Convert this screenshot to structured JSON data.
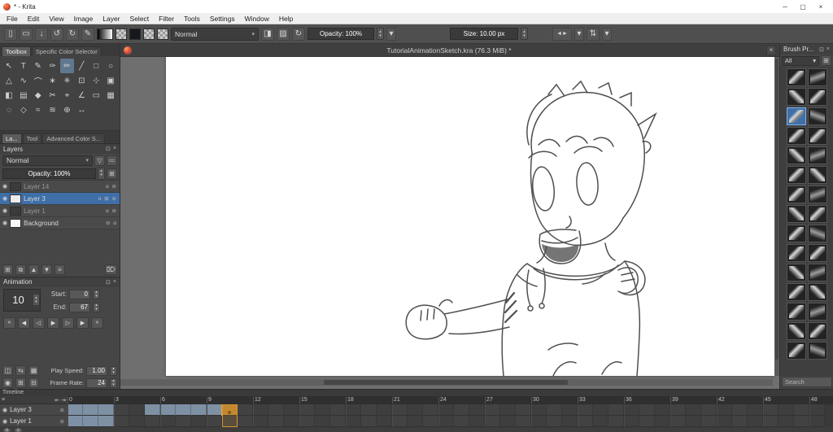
{
  "window": {
    "title": "* - Krita"
  },
  "menubar": {
    "items": [
      "File",
      "Edit",
      "View",
      "Image",
      "Layer",
      "Select",
      "Filter",
      "Tools",
      "Settings",
      "Window",
      "Help"
    ]
  },
  "icons": {
    "minimize": "─",
    "maximize": "▢",
    "close": "×",
    "new_doc": "▯",
    "open_doc": "▭",
    "save_doc": "↓",
    "undo": "↺",
    "redo": "↻",
    "brush_editor": "✎",
    "eraser": "◨",
    "alpha": "▨",
    "reload": "↻",
    "dropdown": "▾",
    "spin_up": "▴",
    "spin_down": "▾",
    "mirror_h": "◄►",
    "mirror_v": "⇅",
    "float_docker": "⊡",
    "filter": "▽",
    "sort": "≔",
    "eye": "◉",
    "add": "⊞",
    "remove": "⊟",
    "menu": "≡",
    "prev_jump": "⇤",
    "next_jump": "⇥",
    "lock": "⊘",
    "search": "⌕"
  },
  "toolbar": {
    "blend_mode": "Normal",
    "opacity": "Opacity:  100%",
    "size": "Size:  10.00 px",
    "opacity_fill": "#5b82ab",
    "size_fill": "#4d7cab"
  },
  "left_dock": {
    "tabs": [
      "Toolbox",
      "Specific Color Selector"
    ],
    "tools": [
      {
        "name": "select-shapes",
        "glyph": "↖"
      },
      {
        "name": "text",
        "glyph": "T"
      },
      {
        "name": "edit-shapes",
        "glyph": "✎"
      },
      {
        "name": "calligraphy",
        "glyph": "✑"
      },
      {
        "name": "freehand-brush",
        "glyph": "✏",
        "active": true
      },
      {
        "name": "line",
        "glyph": "╱"
      },
      {
        "name": "rectangle",
        "glyph": "□"
      },
      {
        "name": "ellipse",
        "glyph": "○"
      },
      {
        "name": "polygon",
        "glyph": "△"
      },
      {
        "name": "polyline",
        "glyph": "∿"
      },
      {
        "name": "bezier-curve",
        "glyph": "⌒"
      },
      {
        "name": "dynamic-brush",
        "glyph": "∗"
      },
      {
        "name": "multibrush",
        "glyph": "✳"
      },
      {
        "name": "transform",
        "glyph": "⊡"
      },
      {
        "name": "move",
        "glyph": "⊹"
      },
      {
        "name": "crop",
        "glyph": "▣"
      },
      {
        "name": "fill",
        "glyph": "◧"
      },
      {
        "name": "gradient",
        "glyph": "▤"
      },
      {
        "name": "color-sampler",
        "glyph": "◆"
      },
      {
        "name": "smart-patch",
        "glyph": "✂"
      },
      {
        "name": "assistants",
        "glyph": "⌖"
      },
      {
        "name": "measure",
        "glyph": "∠"
      },
      {
        "name": "reference-images",
        "glyph": "▭"
      },
      {
        "name": "rect-select",
        "glyph": "▦"
      },
      {
        "name": "ellipse-select",
        "glyph": "◌"
      },
      {
        "name": "poly-select",
        "glyph": "◇"
      },
      {
        "name": "freehand-select",
        "glyph": "≈"
      },
      {
        "name": "similar-select",
        "glyph": "≋"
      },
      {
        "name": "zoom",
        "glyph": "⊕"
      },
      {
        "name": "pan",
        "glyph": "↔"
      }
    ],
    "docker_tabs": [
      "La...",
      "Tool",
      "Advanced Color S..."
    ],
    "layers": {
      "title": "Layers",
      "blend_mode": "Normal",
      "opacity": "Opacity:  100%",
      "opacity_fill": "#4a74a3",
      "rows": [
        {
          "name": "Layer 14",
          "dim": true,
          "selected": false,
          "thumb": "#3b3b3b",
          "badges": "α ⊘"
        },
        {
          "name": "Layer 3",
          "dim": false,
          "selected": true,
          "thumb": "#ececec",
          "badges": "α ⊞ ⊘"
        },
        {
          "name": "Layer 1",
          "dim": true,
          "selected": false,
          "thumb": "#3b3b3b",
          "badges": "α ⊘"
        },
        {
          "name": "Background",
          "dim": false,
          "selected": false,
          "thumb": "#f7f7f7",
          "badges": "⊘ α"
        }
      ],
      "buttons": [
        {
          "name": "add-layer",
          "glyph": "⊞"
        },
        {
          "name": "duplicate-layer",
          "glyph": "⧉"
        },
        {
          "name": "move-layer-up",
          "glyph": "▲"
        },
        {
          "name": "move-layer-down",
          "glyph": "▼"
        },
        {
          "name": "layer-properties",
          "glyph": "≡"
        },
        {
          "name": "delete-layer",
          "glyph": "⌦"
        }
      ]
    },
    "animation": {
      "title": "Animation",
      "current_frame": "10",
      "start_label": "Start:",
      "start_value": "0",
      "end_label": "End:",
      "end_value": "67",
      "transport": [
        {
          "name": "first-frame",
          "glyph": "«"
        },
        {
          "name": "prev-keyframe",
          "glyph": "◀"
        },
        {
          "name": "prev-frame",
          "glyph": "◁"
        },
        {
          "name": "play",
          "glyph": "▶"
        },
        {
          "name": "next-frame",
          "glyph": "▷"
        },
        {
          "name": "next-keyframe",
          "glyph": "▶"
        },
        {
          "name": "last-frame",
          "glyph": "»"
        }
      ],
      "onion_icons": [
        {
          "name": "onion-skin",
          "glyph": "◫"
        },
        {
          "name": "auto-key",
          "glyph": "⇆"
        },
        {
          "name": "drop-frames",
          "glyph": "▦"
        }
      ],
      "settings_icons": [
        {
          "name": "loop",
          "glyph": "◉"
        },
        {
          "name": "add-blank-frame",
          "glyph": "⊞"
        },
        {
          "name": "remove-frame",
          "glyph": "⊟"
        }
      ],
      "play_speed_label": "Play Speed:",
      "play_speed_value": "1.00",
      "frame_rate_label": "Frame Rate:",
      "frame_rate_value": "24"
    }
  },
  "document": {
    "tab_title": "TutorialAnimationSketch.kra (76.3 MiB) *"
  },
  "brush_dock": {
    "title": "Brush Pr...",
    "tag_filter": "All",
    "search_placeholder": "Search",
    "preset_count": 30,
    "selected_index": 4
  },
  "timeline": {
    "title": "Timeline",
    "frame_count": 49,
    "tick_step": 3,
    "current_frame": 10,
    "layers": [
      {
        "name": "Layer 3",
        "keys": [
          0,
          1,
          2,
          5,
          6,
          7,
          8,
          9
        ]
      },
      {
        "name": "Layer 1",
        "keys": [
          0,
          1,
          2
        ]
      }
    ]
  }
}
